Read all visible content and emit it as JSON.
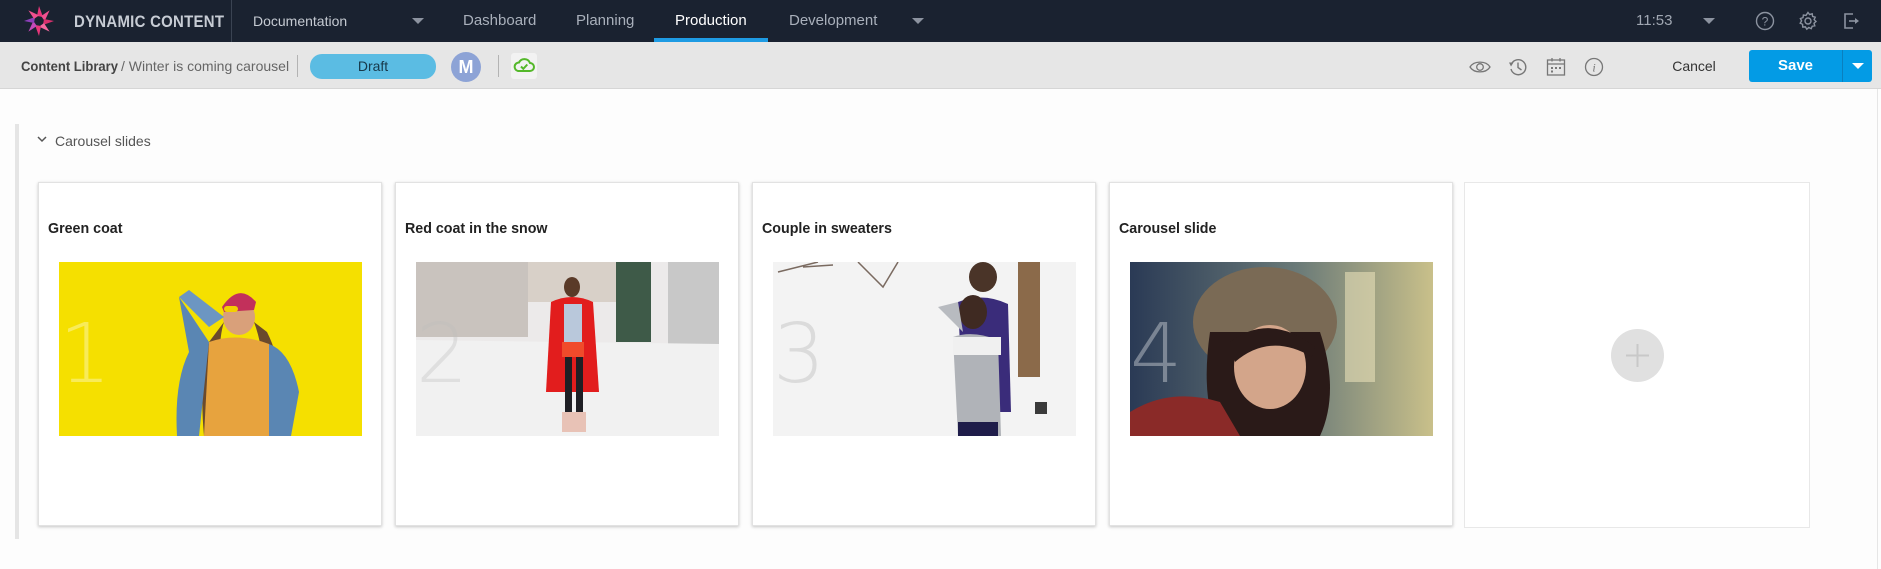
{
  "app": {
    "brand": "DYNAMIC CONTENT",
    "hub": "Documentation",
    "tabs": [
      {
        "label": "Dashboard",
        "active": false
      },
      {
        "label": "Planning",
        "active": false
      },
      {
        "label": "Production",
        "active": true
      },
      {
        "label": "Development",
        "active": false
      }
    ],
    "clock": "11:53",
    "icons": [
      "help-icon",
      "settings-icon",
      "logout-icon"
    ],
    "accent_color": "#1e9be3"
  },
  "toolbar": {
    "breadcrumb_root": "Content Library",
    "breadcrumb_current": "/ Winter is coming carousel",
    "status": "Draft",
    "status_color": "#5bbce3",
    "avatar_initial": "M",
    "icons": [
      "preview-eye-icon",
      "history-icon",
      "schedule-calendar-icon",
      "info-icon"
    ],
    "cancel_label": "Cancel",
    "save_label": "Save",
    "save_color": "#039be5"
  },
  "section": {
    "title": "Carousel slides",
    "expanded": true
  },
  "slides": [
    {
      "number": "1",
      "title": "Green coat",
      "image": "woman in denim jacket against yellow background"
    },
    {
      "number": "2",
      "title": "Red coat in the snow",
      "image": "woman in red coat on snowy street"
    },
    {
      "number": "3",
      "title": "Couple in sweaters",
      "image": "couple in sweaters in snowy forest"
    },
    {
      "number": "4",
      "title": "Carousel slide",
      "image": "woman in knitted hat with falling snow"
    }
  ],
  "add_slide": {
    "icon": "plus-icon"
  }
}
